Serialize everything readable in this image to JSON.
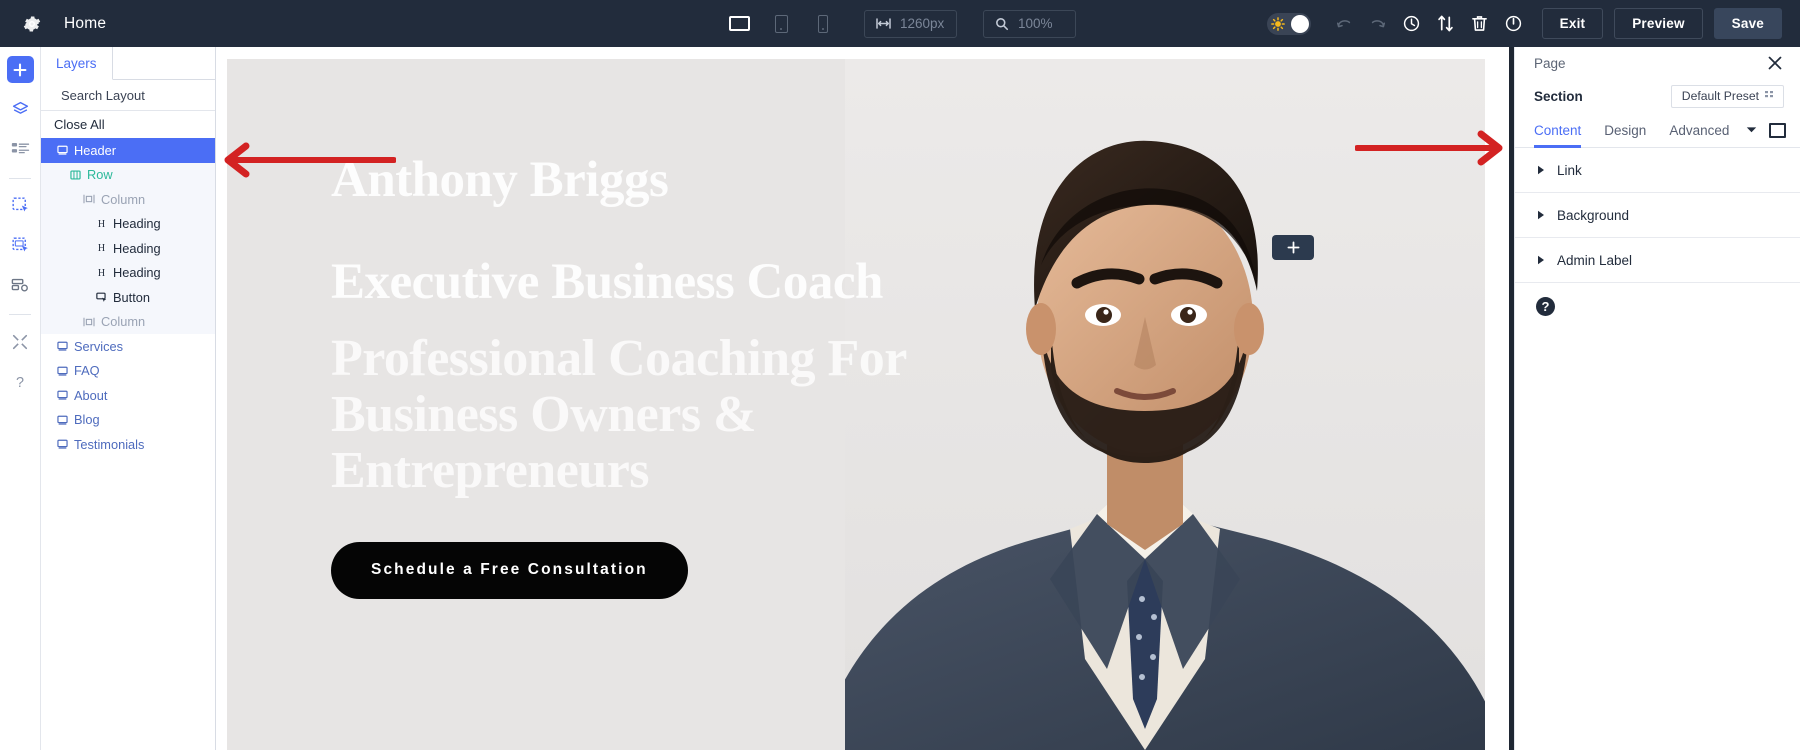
{
  "topbar": {
    "gear_icon": "gear-icon",
    "title": "Home",
    "devices": [
      {
        "name": "desktop",
        "label": "Desktop",
        "active": true
      },
      {
        "name": "tablet",
        "label": "Tablet",
        "active": false
      },
      {
        "name": "mobile",
        "label": "Mobile",
        "active": false
      }
    ],
    "width_field": {
      "icon": "width-arrows-icon",
      "value": "1260px"
    },
    "zoom_field": {
      "icon": "magnifier-icon",
      "value": "100%"
    },
    "toggle": {
      "name": "wireframe-toggle",
      "icon": "sun-icon",
      "state": "on"
    },
    "tools": [
      {
        "name": "undo-icon",
        "label": "Undo"
      },
      {
        "name": "redo-icon",
        "label": "Redo"
      },
      {
        "name": "history-clock-icon",
        "label": "History"
      },
      {
        "name": "sort-arrows-icon",
        "label": "Sort"
      },
      {
        "name": "trash-icon",
        "label": "Delete"
      },
      {
        "name": "power-icon",
        "label": "Power"
      }
    ],
    "exit_label": "Exit",
    "preview_label": "Preview",
    "save_label": "Save",
    "bg": "#222c3c",
    "accent": "#4b6ef5"
  },
  "rail": {
    "items": [
      {
        "name": "add-icon",
        "label": "Add",
        "primary": true
      },
      {
        "name": "layers-stack-icon",
        "label": "Layers"
      },
      {
        "name": "layout-list-icon",
        "label": "Layout"
      },
      {
        "name": "select-section-icon",
        "label": "Select Section"
      },
      {
        "name": "select-row-icon",
        "label": "Select Row"
      },
      {
        "name": "select-module-icon",
        "label": "Select Module"
      },
      {
        "name": "tools-icon",
        "label": "Tools"
      },
      {
        "name": "help-icon",
        "label": "Help"
      }
    ]
  },
  "layers": {
    "tab_label": "Layers",
    "search_placeholder": "Search Layout",
    "filter_icon": "filter-icon",
    "close_all_label": "Close All",
    "tree": [
      {
        "label": "Header",
        "icon": "section-icon",
        "indent": 0,
        "color": "blue",
        "selected": true
      },
      {
        "label": "Row",
        "icon": "row-icon",
        "indent": 1,
        "color": "teal",
        "selected": false
      },
      {
        "label": "Column",
        "icon": "column-icon",
        "indent": 2,
        "color": "gray",
        "selected": false
      },
      {
        "label": "Heading",
        "icon": "heading-icon",
        "indent": 3,
        "color": "dark",
        "selected": false
      },
      {
        "label": "Heading",
        "icon": "heading-icon",
        "indent": 3,
        "color": "dark",
        "selected": false
      },
      {
        "label": "Heading",
        "icon": "heading-icon",
        "indent": 3,
        "color": "dark",
        "selected": false
      },
      {
        "label": "Button",
        "icon": "button-icon",
        "indent": 3,
        "color": "dark",
        "selected": false
      },
      {
        "label": "Column",
        "icon": "column-icon",
        "indent": 2,
        "color": "gray",
        "selected": false
      },
      {
        "label": "Services",
        "icon": "section-icon",
        "indent": 0,
        "color": "blue",
        "selected": false
      },
      {
        "label": "FAQ",
        "icon": "section-icon",
        "indent": 0,
        "color": "blue",
        "selected": false
      },
      {
        "label": "About",
        "icon": "section-icon",
        "indent": 0,
        "color": "blue",
        "selected": false
      },
      {
        "label": "Blog",
        "icon": "section-icon",
        "indent": 0,
        "color": "blue",
        "selected": false
      },
      {
        "label": "Testimonials",
        "icon": "section-icon",
        "indent": 0,
        "color": "blue",
        "selected": false
      }
    ]
  },
  "canvas": {
    "hero": {
      "name": "Anthony Briggs",
      "role": "Executive Business Coach",
      "headline": "Professional Coaching For Business Owners & Entrepreneurs",
      "cta_label": "Schedule a Free Consultation",
      "bg_color": "#e7e5e4"
    },
    "add_badge": {
      "name": "add-section-badge",
      "glyph": "+"
    },
    "annotations": [
      {
        "name": "left-arrow-annotation",
        "direction": "left",
        "color": "#d32222"
      },
      {
        "name": "right-arrow-annotation",
        "direction": "right",
        "color": "#d32222"
      }
    ]
  },
  "right_panel": {
    "title": "Page",
    "close_icon": "close-icon",
    "section_label": "Section",
    "preset_value": "Default Preset",
    "preset_icon": "preset-icon",
    "tabs": [
      {
        "label": "Content",
        "active": true
      },
      {
        "label": "Design",
        "active": false
      },
      {
        "label": "Advanced",
        "active": false
      }
    ],
    "tab_right_icons": [
      {
        "name": "chevron-down-icon"
      },
      {
        "name": "expand-square-icon"
      }
    ],
    "accordions": [
      {
        "label": "Link"
      },
      {
        "label": "Background"
      },
      {
        "label": "Admin Label"
      }
    ],
    "help_glyph": "?"
  }
}
